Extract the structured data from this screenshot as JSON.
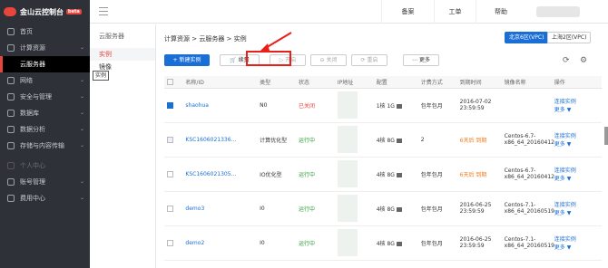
{
  "sidebar": {
    "brand": "金山云控制台",
    "beta": "beta",
    "items": [
      {
        "label": "首页",
        "icon": "home-icon",
        "chevron": ""
      },
      {
        "label": "计算资源",
        "icon": "server-icon",
        "chevron": "⌄"
      },
      {
        "label": "云服务器",
        "icon": "",
        "chevron": ""
      },
      {
        "label": "网络",
        "icon": "network-icon",
        "chevron": "⌄"
      },
      {
        "label": "安全与管理",
        "icon": "shield-icon",
        "chevron": "⌄"
      },
      {
        "label": "数据库",
        "icon": "database-icon",
        "chevron": "⌄"
      },
      {
        "label": "数据分析",
        "icon": "analytics-icon",
        "chevron": "⌄"
      },
      {
        "label": "存储与内容传输",
        "icon": "storage-icon",
        "chevron": "⌄"
      },
      {
        "label": "个人中心",
        "icon": "user-icon",
        "chevron": ""
      },
      {
        "label": "账号管理",
        "icon": "account-icon",
        "chevron": "⌄"
      },
      {
        "label": "费用中心",
        "icon": "billing-icon",
        "chevron": "⌄"
      }
    ]
  },
  "topbar": {
    "record": "备案",
    "ticket": "工单",
    "help": "帮助"
  },
  "subnav": {
    "header": "云服务器",
    "items": [
      "实例",
      "镜像"
    ],
    "tooltip": "实例"
  },
  "main": {
    "breadcrumb": "计算资源 > 云服务器 > 实例",
    "regions": [
      "北京6区(VPC)",
      "上海2区(VPC)"
    ],
    "buttons": {
      "new": "+ 新建实例",
      "renew": "续费",
      "start": "开启",
      "stop": "关闭",
      "restart": "重启",
      "more": "更多"
    },
    "columns": [
      "名称/ID",
      "类型",
      "状态",
      "IP地址",
      "配置",
      "计费方式",
      "到期时间",
      "镜像名称",
      "操作"
    ],
    "rows": [
      {
        "name": "shaohua",
        "type": "N0",
        "status": "已关闭",
        "config": "1核 1G",
        "billing": "包年包月",
        "expire": "2016-07-02 23:59:59",
        "image": "",
        "op": "连接实例",
        "more": "更多 ▼",
        "checked": true
      },
      {
        "name": "KSC1606021336...",
        "type": "计算优化型",
        "status": "运行中",
        "config": "4核 8G",
        "billing": "2",
        "expire": "6天后 到期",
        "image": "Centos-6.7-x86_64_20160412",
        "op": "连接实例",
        "more": "更多 ▼",
        "checked": false
      },
      {
        "name": "KSC1606021305...",
        "type": "IO优化型",
        "status": "运行中",
        "config": "4核 8G",
        "billing": "包年包月",
        "expire": "6天后 到期",
        "image": "Centos-6.7-x86_64_20160412",
        "op": "连接实例",
        "more": "更多 ▼",
        "checked": false
      },
      {
        "name": "demo3",
        "type": "I0",
        "status": "运行中",
        "config": "4核 8G",
        "billing": "包年包月",
        "expire": "2016-06-25 23:59:59",
        "image": "Centos-7.1-x86_64_20160519",
        "op": "连接实例",
        "more": "更多 ▼",
        "checked": false
      },
      {
        "name": "demo2",
        "type": "I0",
        "status": "运行中",
        "config": "4核 8G",
        "billing": "包年包月",
        "expire": "2016-06-25 23:59:59",
        "image": "Centos-7.1-x86_64_20160519",
        "op": "连接实例",
        "more": "更多 ▼",
        "checked": false
      }
    ]
  },
  "colors": {
    "accent": "#1a6fd6",
    "danger": "#e8453c",
    "success": "#2a9d3a",
    "sidebar": "#2e3238"
  }
}
